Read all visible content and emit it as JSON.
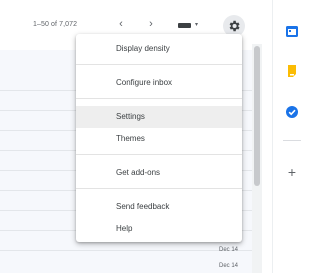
{
  "toolbar": {
    "page_count": "1–50 of 7,072",
    "prev_glyph": "‹",
    "next_glyph": "›",
    "density_caret": "▾"
  },
  "icons": {
    "prev": "chevron-left-icon",
    "next": "chevron-right-icon",
    "density": "density-icon",
    "settings": "gear-icon",
    "calendar": "calendar-icon",
    "keep": "keep-icon",
    "tasks": "tasks-icon",
    "add": "add-icon"
  },
  "settings_menu": {
    "items": [
      {
        "label": "Display density"
      },
      {
        "label": "Configure inbox"
      },
      {
        "label": "Settings"
      },
      {
        "label": "Themes"
      },
      {
        "label": "Get add-ons"
      },
      {
        "label": "Send feedback"
      },
      {
        "label": "Help"
      }
    ],
    "hovered_item": "Settings"
  },
  "inbox": {
    "dates": [
      "Dec 14",
      "Dec 14"
    ]
  },
  "side_panel": {
    "add_glyph": "+"
  },
  "colors": {
    "calendar": "#1a73e8",
    "keep": "#fbbc04",
    "tasks": "#1a73e8",
    "list_bg": "#f6f8fc",
    "menu_hover": "#eeeeee"
  }
}
